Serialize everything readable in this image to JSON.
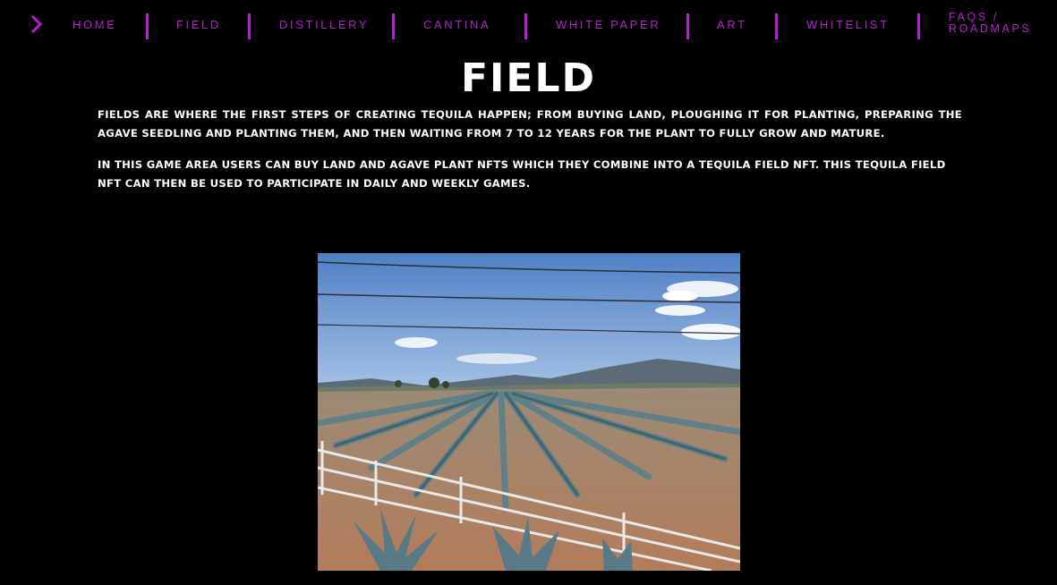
{
  "nav": {
    "items": [
      {
        "label": "HOME"
      },
      {
        "label": "FIELD"
      },
      {
        "label": "DISTILLERY"
      },
      {
        "label": "CANTINA"
      },
      {
        "label": "WHITE PAPER"
      },
      {
        "label": "ART"
      },
      {
        "label": "WHITELIST"
      },
      {
        "label_line1": "FAQS /",
        "label_line2": "ROADMAPS"
      }
    ]
  },
  "colors": {
    "accent": "#b81fd1",
    "background": "#000000",
    "text": "#ffffff"
  },
  "main": {
    "title": "FIELD",
    "paragraph1": "Fields are where the first steps of creating tequila happen; from buying land, ploughing it for planting, preparing the agave seedling and planting them, and then waiting from 7 to 12 years for the plant to fully grow and mature.",
    "paragraph2": "In this game area users can buy land and agave plant NFTs which they combine into a tequila field NFT. This tequila field NFT can then be used to participate in daily and weekly games."
  }
}
